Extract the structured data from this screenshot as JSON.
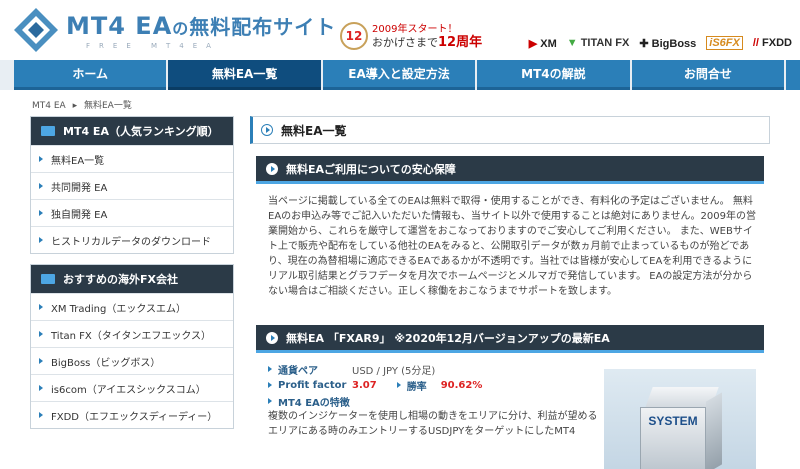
{
  "header": {
    "logo_main_ea": "MT4 EA",
    "logo_no": "の",
    "logo_jp": "無料配布サイト",
    "logo_sub": "FREE MT4EA",
    "anniv_badge": "12",
    "anniv_line1": "2009年スタート！",
    "anniv_line2_prefix": "おかげさまで",
    "anniv_line2_bold": "12周年",
    "brokers": [
      "XM",
      "TITAN FX",
      "BigBoss",
      "iS6FX",
      "FXDD"
    ]
  },
  "nav": {
    "items": [
      "ホーム",
      "無料EA一覧",
      "EA導入と設定方法",
      "MT4の解説",
      "お問合せ"
    ],
    "active_index": 1
  },
  "breadcrumb": {
    "home": "MT4 EA",
    "sep": "▸",
    "current": "無料EA一覧"
  },
  "sidebar": {
    "box1": {
      "title": "MT4 EA（人気ランキング順）",
      "items": [
        "無料EA一覧",
        "共同開発 EA",
        "独自開発 EA",
        "ヒストリカルデータのダウンロード"
      ]
    },
    "box2": {
      "title": "おすすめの海外FX会社",
      "items": [
        "XM Trading（エックスエム）",
        "Titan FX（タイタンエフエックス）",
        "BigBoss（ビッグボス）",
        "is6com（アイエスシックスコム）",
        "FXDD（エフエックスディーディー）"
      ]
    }
  },
  "main": {
    "page_title": "無料EA一覧",
    "section1": {
      "title": "無料EAご利用についての安心保障",
      "text": "当ページに掲載している全てのEAは無料で取得・使用することができ、有料化の予定はございません。 無料EAのお申込み等でご記入いただいた情報も、当サイト以外で使用することは絶対にありません。2009年の営業開始から、これらを厳守して運営をおこなっておりますのでご安心してご利用ください。 また、WEBサイト上で販売や配布をしている他社のEAをみると、公開取引データが数ヵ月前で止まっているものが殆どであり、現在の為替相場に適応できるEAであるかが不透明です。当社では皆様が安心してEAを利用できるようにリアル取引結果とグラフデータを月次でホームページとメルマガで発信しています。 EAの設定方法が分からない場合はご相談ください。正しく稼働をおこなうまでサポートを致します。"
    },
    "section2": {
      "title": "無料EA 「FXAR9」 ※2020年12月バージョンアップの最新EA",
      "pair_label": "通貨ペア",
      "pair_value": "USD / JPY (5分足)",
      "pf_label": "Profit factor",
      "pf_value": "3.07",
      "win_label": "勝率",
      "win_value": "90.62%",
      "feature_label": "MT4 EAの特徴",
      "feature_text": "複数のインジケーターを使用し相場の動きをエリアに分け、利益が望めるエリアにある時のみエントリーするUSDJPYをターゲットにしたMT4",
      "image_label": "SYSTEM"
    }
  },
  "colors": {
    "nav_blue": "#2b7fb8",
    "nav_active": "#0f4d7e",
    "dark_header": "#2b3a47",
    "accent_red": "#d22222"
  }
}
